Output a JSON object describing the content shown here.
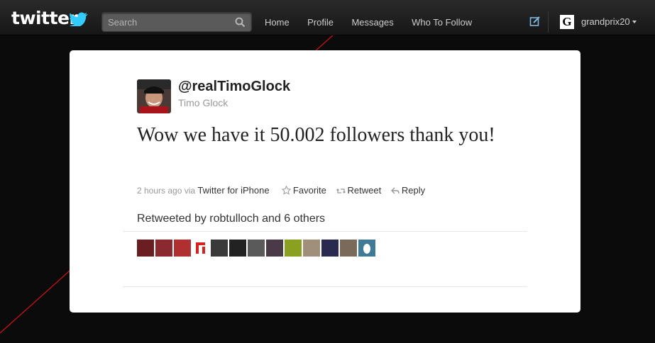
{
  "header": {
    "logo_text": "twitter",
    "search_placeholder": "Search",
    "nav": [
      "Home",
      "Profile",
      "Messages",
      "Who To Follow"
    ],
    "user_name": "grandprix20",
    "user_logo_letter": "G",
    "icons": [
      "bird-icon",
      "search-icon",
      "compose-icon",
      "caret-down-icon"
    ]
  },
  "tweet": {
    "handle": "@realTimoGlock",
    "name": "Timo Glock",
    "text": "Wow we have it 50.002 followers thank you!",
    "time": "2 hours ago",
    "via": "via",
    "source": "Twitter for iPhone",
    "actions": {
      "favorite": "Favorite",
      "retweet": "Retweet",
      "reply": "Reply"
    },
    "retweeted_by": "Retweeted by robtulloch and 6 others",
    "retweeter_avatars": [
      "#6a1e22",
      "#8a2a30",
      "#b03030",
      "#d8201c",
      "#3a3a3a",
      "#222222",
      "#5a5a5a",
      "#4a3a48",
      "#8aa020",
      "#a0907a",
      "#2a2a50",
      "#7a6a5a",
      "#3f7a96"
    ]
  },
  "colors": {
    "accent_red": "#cc1111",
    "twitter_blue": "#33ccff"
  }
}
